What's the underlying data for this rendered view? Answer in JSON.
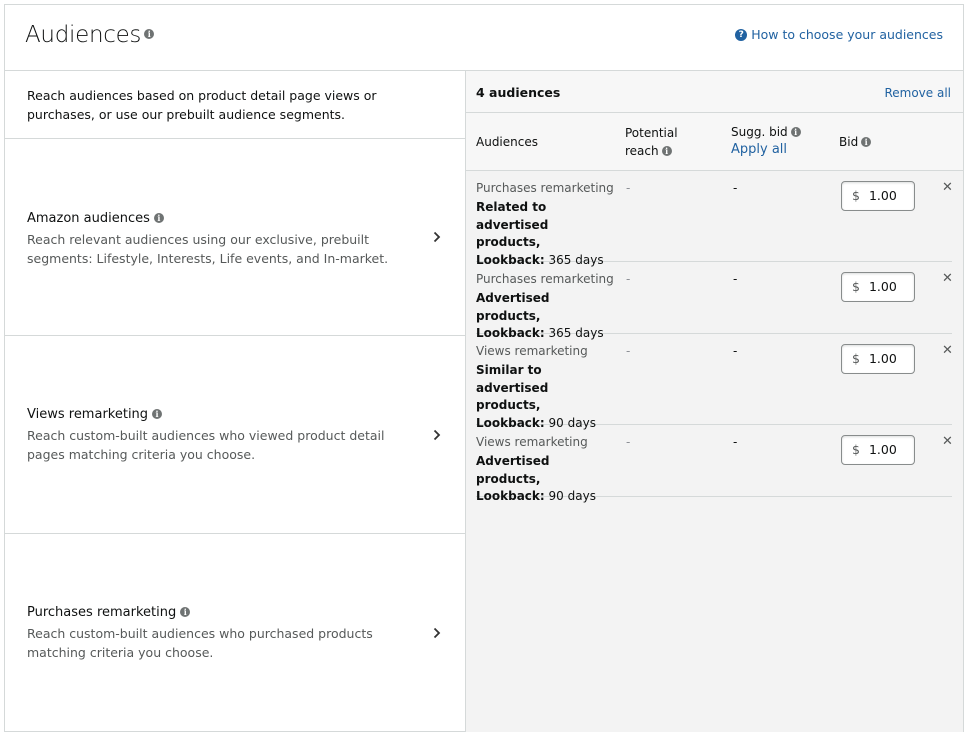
{
  "header": {
    "title": "Audiences",
    "help_link": "How to choose your audiences"
  },
  "left": {
    "intro": "Reach audiences based on product detail page views or purchases, or use our prebuilt audience segments.",
    "cards": [
      {
        "title": "Amazon audiences",
        "description": "Reach relevant audiences using our exclusive, prebuilt segments: Lifestyle, Interests, Life events, and In-market."
      },
      {
        "title": "Views remarketing",
        "description": "Reach custom-built audiences who viewed product detail pages matching criteria you choose."
      },
      {
        "title": "Purchases remarketing",
        "description": "Reach custom-built audiences who purchased products matching criteria you choose."
      }
    ]
  },
  "right": {
    "count_label": "4 audiences",
    "remove_all": "Remove all",
    "columns": {
      "audiences": "Audiences",
      "reach_line1": "Potential",
      "reach_line2": "reach",
      "sugg_bid": "Sugg. bid",
      "apply_all": "Apply all",
      "bid": "Bid"
    },
    "rows": [
      {
        "type": "Purchases remarketing",
        "detail_bold": "Related to advertised products,",
        "lookback_label": "Lookback:",
        "lookback_value": "365 days",
        "reach": "-",
        "sugg_bid": "-",
        "currency": "$",
        "bid": "1.00"
      },
      {
        "type": "Purchases remarketing",
        "detail_bold": "Advertised products,",
        "lookback_label": "Lookback:",
        "lookback_value": "365 days",
        "reach": "-",
        "sugg_bid": "-",
        "currency": "$",
        "bid": "1.00"
      },
      {
        "type": "Views remarketing",
        "detail_bold": "Similar to advertised products,",
        "lookback_label": "Lookback:",
        "lookback_value": "90 days",
        "reach": "-",
        "sugg_bid": "-",
        "currency": "$",
        "bid": "1.00"
      },
      {
        "type": "Views remarketing",
        "detail_bold": "Advertised products,",
        "lookback_label": "Lookback:",
        "lookback_value": "90 days",
        "reach": "-",
        "sugg_bid": "-",
        "currency": "$",
        "bid": "1.00"
      }
    ]
  }
}
